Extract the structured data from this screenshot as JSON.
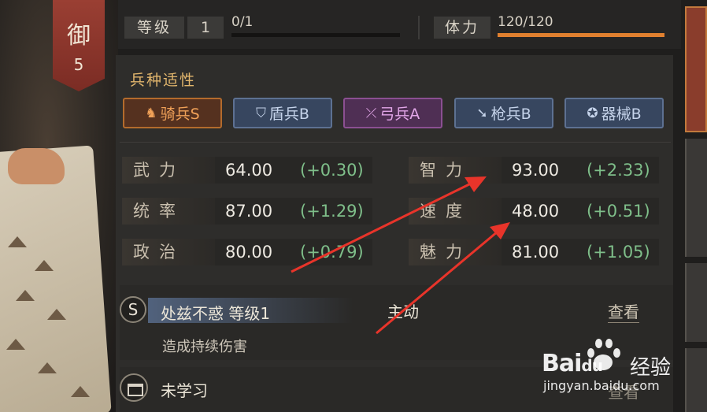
{
  "rank": {
    "title": "御",
    "number": "5"
  },
  "level": {
    "label": "等级",
    "value": "1",
    "exp": "0/1",
    "exp_progress": 0.0
  },
  "stamina": {
    "label": "体力",
    "value": "120/120",
    "progress": 1.0
  },
  "troop_aptitude": {
    "title": "兵种适性",
    "items": [
      {
        "label": "骑兵S",
        "icon": "horse-icon"
      },
      {
        "label": "盾兵B",
        "icon": "shield-icon"
      },
      {
        "label": "弓兵A",
        "icon": "bow-icon"
      },
      {
        "label": "枪兵B",
        "icon": "spear-icon"
      },
      {
        "label": "器械B",
        "icon": "siege-icon"
      }
    ]
  },
  "stats": {
    "left": [
      {
        "name": "武力",
        "value": "64.00",
        "bonus": "(+0.30)"
      },
      {
        "name": "统率",
        "value": "87.00",
        "bonus": "(+1.29)"
      },
      {
        "name": "政治",
        "value": "80.00",
        "bonus": "(+0.79)"
      }
    ],
    "right": [
      {
        "name": "智力",
        "value": "93.00",
        "bonus": "(+2.33)"
      },
      {
        "name": "速度",
        "value": "48.00",
        "bonus": "(+0.51)"
      },
      {
        "name": "魅力",
        "value": "81.00",
        "bonus": "(+1.05)"
      }
    ]
  },
  "skill": {
    "grade": "S",
    "name": "处兹不惑 等级1",
    "type": "主动",
    "view_label": "查看",
    "description": "造成持续伤害"
  },
  "slot2": {
    "label": "未学习",
    "action": "查看"
  },
  "watermark": {
    "brand": "Bai",
    "brand_suffix": "经验",
    "brand_mid": "du",
    "url": "jingyan.baidu.com"
  },
  "colors": {
    "accent_orange": "#e0802f",
    "gold": "#e2b66d",
    "bonus_green": "#7fbf8a",
    "arrow_red": "#e8342a"
  }
}
